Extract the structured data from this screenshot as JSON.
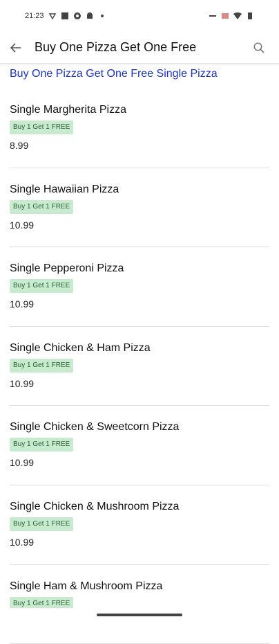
{
  "status_bar": {
    "time": "21:23"
  },
  "app_bar": {
    "title": "Buy One Pizza Get One Free"
  },
  "section": {
    "heading": "Buy One Pizza Get One Free Single Pizza"
  },
  "items": [
    {
      "name": "Single Margherita Pizza",
      "badge": "Buy 1 Get 1 FREE",
      "price": "8.99"
    },
    {
      "name": "Single Hawaiian Pizza",
      "badge": "Buy 1 Get 1 FREE",
      "price": "10.99"
    },
    {
      "name": "Single Pepperoni Pizza",
      "badge": "Buy 1 Get 1 FREE",
      "price": "10.99"
    },
    {
      "name": "Single Chicken & Ham Pizza",
      "badge": "Buy 1 Get 1 FREE",
      "price": "10.99"
    },
    {
      "name": "Single Chicken & Sweetcorn Pizza",
      "badge": "Buy 1 Get 1 FREE",
      "price": "10.99"
    },
    {
      "name": "Single Chicken & Mushroom Pizza",
      "badge": "Buy 1 Get 1 FREE",
      "price": "10.99"
    },
    {
      "name": "Single Ham & Mushroom Pizza",
      "badge": "Buy 1 Get 1 FREE",
      "price": ""
    }
  ],
  "icons": {
    "back": "arrow-left-icon",
    "search": "search-icon"
  },
  "colors": {
    "heading": "#1a33c7",
    "badge_bg": "#c8ebcf",
    "badge_text": "#2b5d35"
  }
}
